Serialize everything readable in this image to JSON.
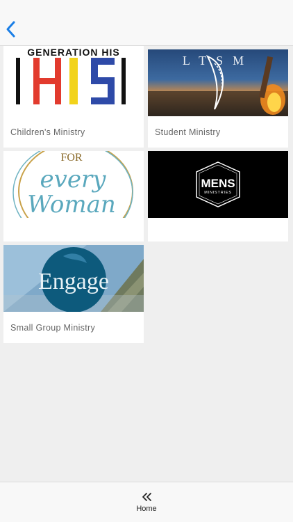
{
  "header": {
    "back_icon": "chevron-left-icon",
    "accent_color": "#1a7ee6"
  },
  "cards": [
    {
      "label": "Children's Ministry",
      "image_text": "GENERATION HIS"
    },
    {
      "label": "Student Ministry",
      "image_text": "LTSM"
    },
    {
      "label": "",
      "image_text_top": "FOR",
      "image_text_mid": "every",
      "image_text_bottom": "Woman"
    },
    {
      "label": "",
      "image_text_top": "MENS",
      "image_text_bottom": "MINISTRIES"
    },
    {
      "label": "Small Group Ministry",
      "image_text": "Engage"
    }
  ],
  "footer": {
    "home_icon": "double-chevron-left-icon",
    "home_label": "Home"
  }
}
